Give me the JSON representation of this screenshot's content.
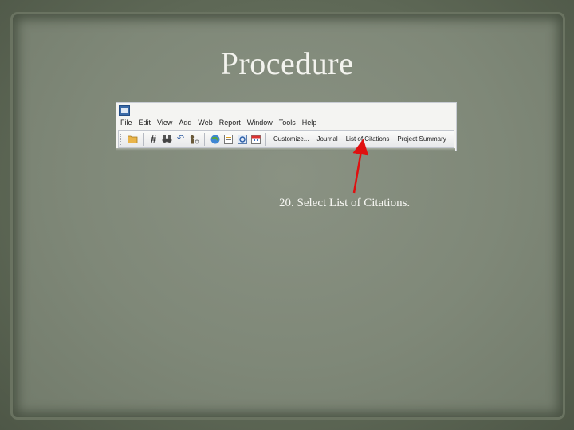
{
  "slide": {
    "title": "Procedure",
    "caption": "20. Select List of Citations."
  },
  "app": {
    "menu": [
      "File",
      "Edit",
      "View",
      "Add",
      "Web",
      "Report",
      "Window",
      "Tools",
      "Help"
    ],
    "toolbar_icons": [
      "open-folder-icon",
      "hash-icon",
      "binoculars-icon",
      "undo-icon",
      "person-settings-icon",
      "globe-icon",
      "notes-icon",
      "refresh-icon",
      "calendar-icon"
    ],
    "toolbar_buttons": {
      "customize": "Customize...",
      "journal": "Journal",
      "list_of_citations": "List of Citations",
      "project_summary": "Project Summary"
    }
  },
  "colors": {
    "arrow": "#e01010",
    "title_text": "#f3f3ee"
  }
}
